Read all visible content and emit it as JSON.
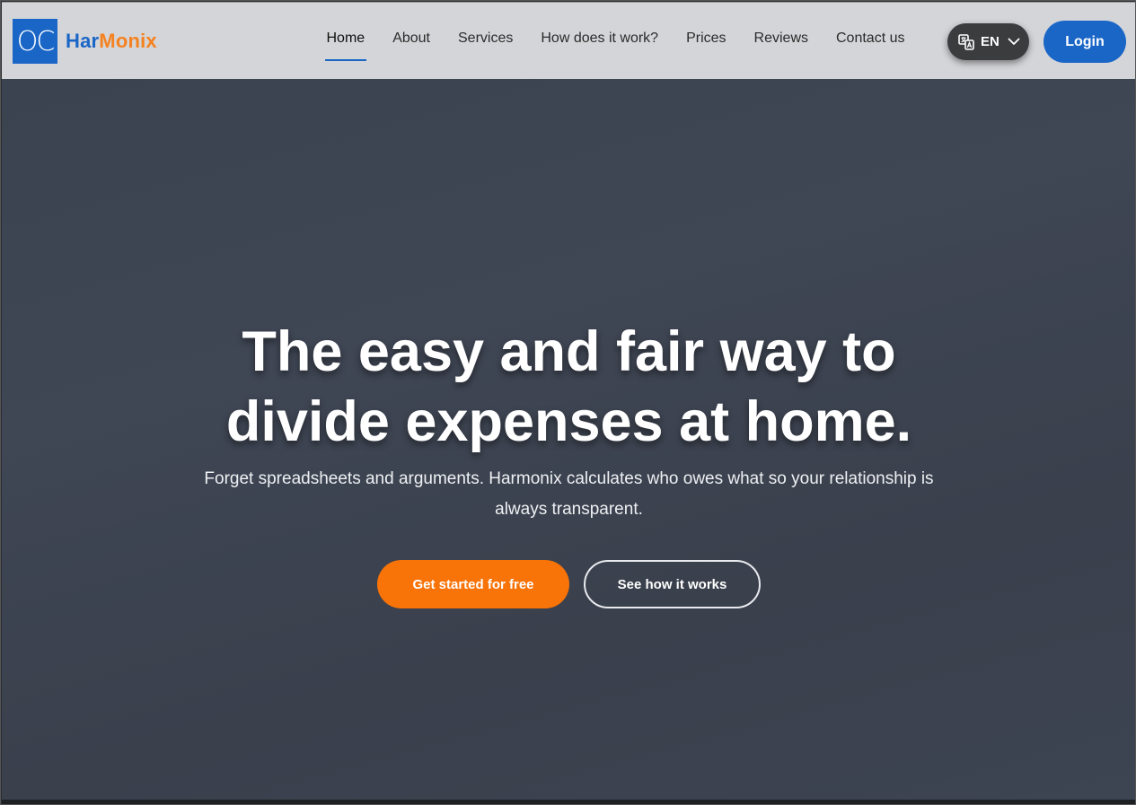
{
  "header": {
    "logo_mark": "OC",
    "logo_text_part1": "Har",
    "logo_text_part2": "Monix",
    "nav": [
      {
        "label": "Home",
        "active": true
      },
      {
        "label": "About"
      },
      {
        "label": "Services"
      },
      {
        "label": "How does it work?"
      },
      {
        "label": "Prices"
      },
      {
        "label": "Reviews"
      },
      {
        "label": "Contact us"
      }
    ],
    "language": {
      "code": "EN",
      "icon": "translate-icon"
    },
    "login_label": "Login"
  },
  "hero": {
    "title_line1": "The easy and fair way to",
    "title_line2": "divide expenses at home.",
    "subtitle_line1": "Forget spreadsheets and arguments. Harmonix calculates who owes what so your relationship is",
    "subtitle_line2": "always transparent.",
    "cta_primary": "Get started for free",
    "cta_secondary": "See how it works"
  },
  "colors": {
    "brand_blue": "#1a66c7",
    "brand_orange": "#f58220",
    "cta_orange": "#f87308"
  }
}
